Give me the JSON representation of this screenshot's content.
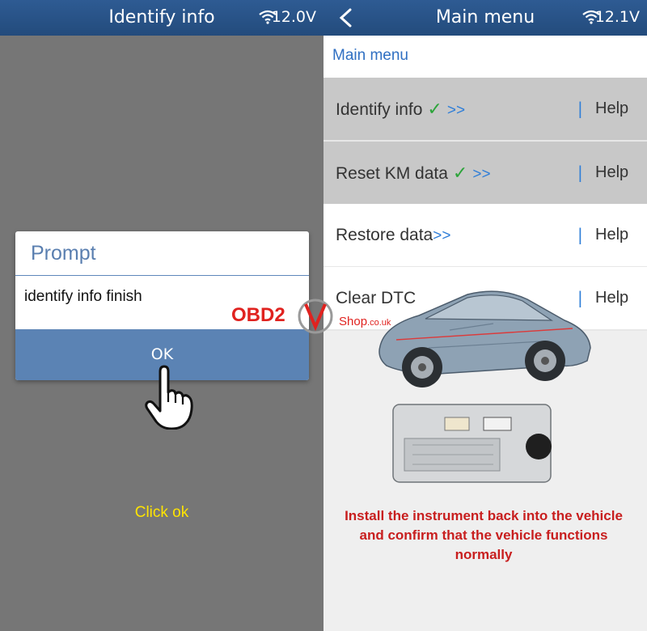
{
  "left_screen": {
    "title": "Identify info",
    "voltage": "12.0V",
    "dialog": {
      "title": "Prompt",
      "message": "identify info finish",
      "ok_label": "OK"
    },
    "instruction": "Click ok"
  },
  "right_screen": {
    "title": "Main menu",
    "voltage": "12.1V",
    "subheader": "Main menu",
    "menu_items": [
      {
        "label": "Identify info",
        "checked": true,
        "arrow": ">>",
        "help": "Help"
      },
      {
        "label": "Reset KM data",
        "checked": true,
        "arrow": ">>",
        "help": "Help"
      },
      {
        "label": "Restore data",
        "checked": false,
        "arrow": ">>",
        "help": "Help"
      },
      {
        "label": "Clear DTC",
        "checked": false,
        "arrow": "",
        "help": "Help"
      }
    ],
    "check_glyph": "✓",
    "separator": "|",
    "note": "Install the instrument back into the vehicle and confirm that the vehicle functions normally"
  },
  "watermark": {
    "brand": "OBD2",
    "shop": "Shop",
    "domain": ".co.uk"
  },
  "colors": {
    "header": "#2a5487",
    "accent": "#2f7ed8",
    "check": "#2ca43a",
    "note": "#c81e1e",
    "instruction": "#ffe400",
    "left_bg": "#767676"
  },
  "icons": [
    "wifi-icon",
    "back-arrow-icon",
    "pointing-hand-icon",
    "car-illustration",
    "instrument-cluster-image"
  ]
}
